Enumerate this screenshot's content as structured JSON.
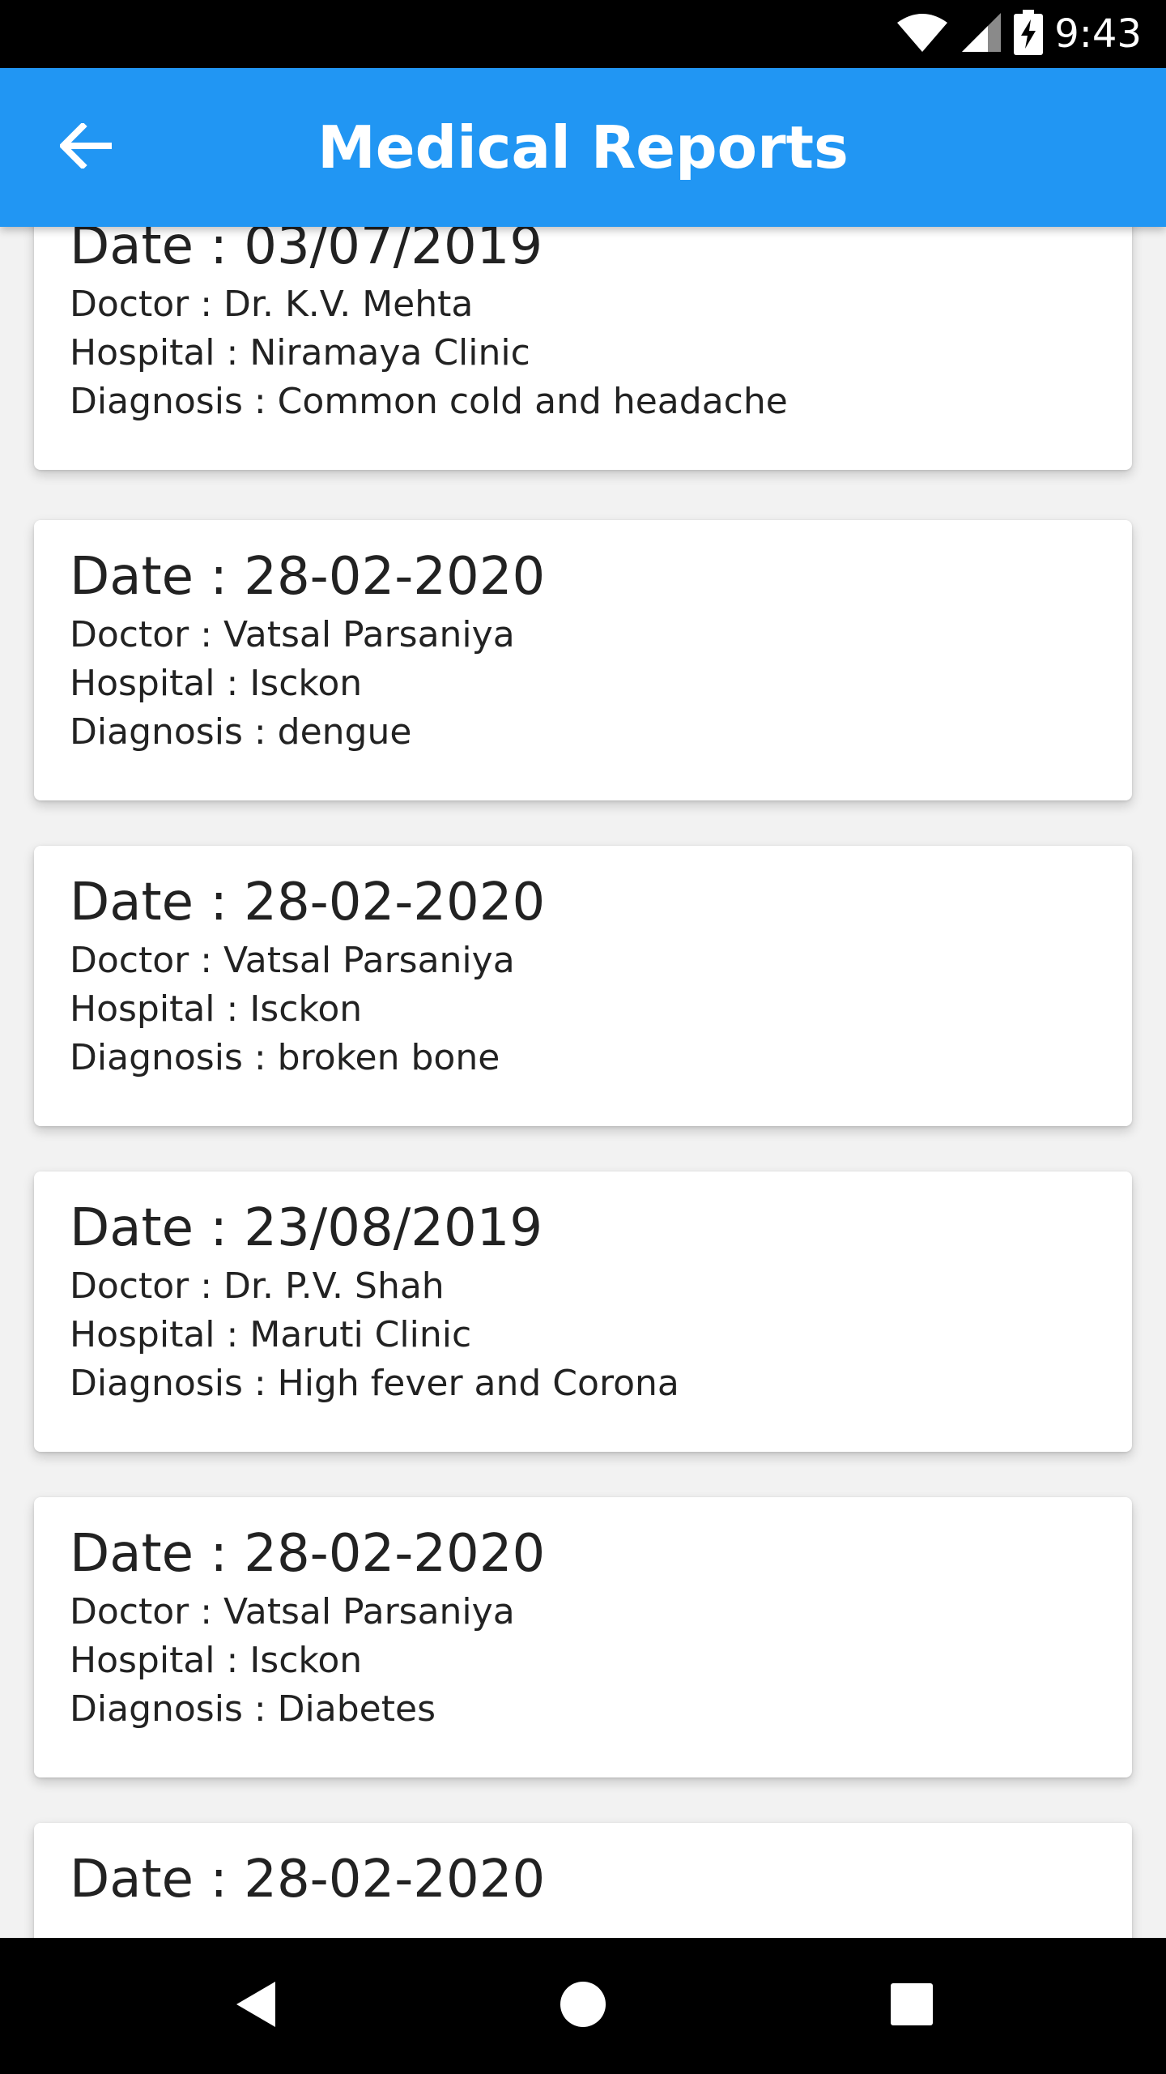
{
  "status_bar": {
    "time": "9:43",
    "icons": [
      "wifi-icon",
      "signal-icon",
      "battery-charging-icon"
    ]
  },
  "app_bar": {
    "title": "Medical Reports",
    "back_icon": "arrow-left-icon",
    "background_color": "#2196f3"
  },
  "reports": [
    {
      "date": "Date : 03/07/2019",
      "doctor": "Doctor : Dr. K.V. Mehta",
      "hospital": "Hospital : Niramaya Clinic",
      "diagnosis": "Diagnosis : Common cold and headache"
    },
    {
      "date": "Date : 28-02-2020",
      "doctor": "Doctor : Vatsal Parsaniya",
      "hospital": "Hospital : Isckon",
      "diagnosis": "Diagnosis : dengue"
    },
    {
      "date": "Date : 28-02-2020",
      "doctor": "Doctor : Vatsal Parsaniya",
      "hospital": "Hospital : Isckon",
      "diagnosis": "Diagnosis : broken bone"
    },
    {
      "date": "Date : 23/08/2019",
      "doctor": "Doctor : Dr. P.V. Shah",
      "hospital": "Hospital : Maruti Clinic",
      "diagnosis": "Diagnosis : High fever and Corona"
    },
    {
      "date": "Date : 28-02-2020",
      "doctor": "Doctor : Vatsal Parsaniya",
      "hospital": "Hospital : Isckon",
      "diagnosis": "Diagnosis : Diabetes"
    },
    {
      "date": "Date : 28-02-2020"
    }
  ],
  "nav_bar": {
    "buttons": [
      "back-triangle-icon",
      "home-circle-icon",
      "recents-square-icon"
    ]
  }
}
